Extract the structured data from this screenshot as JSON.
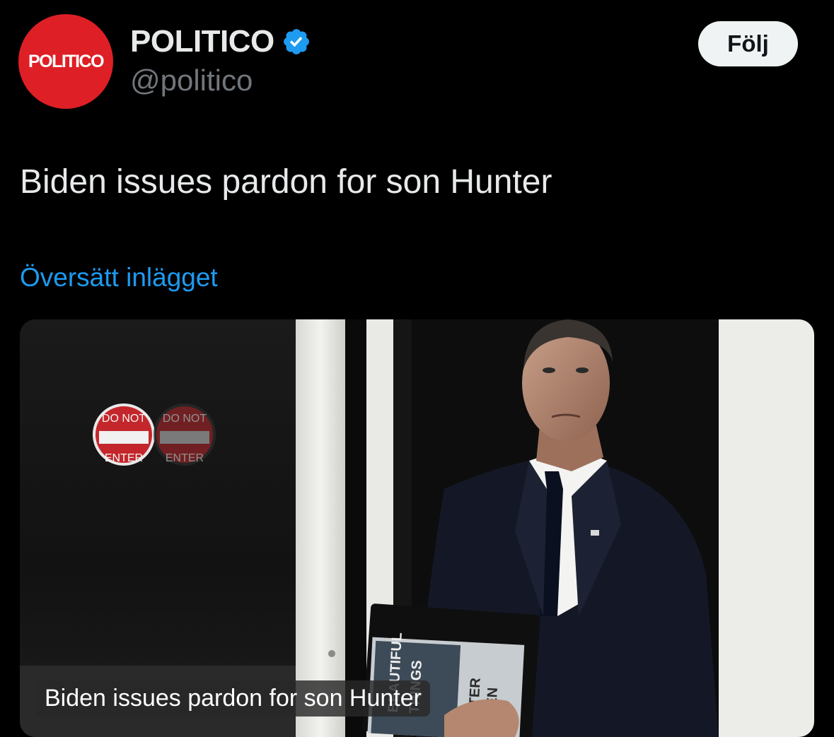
{
  "account": {
    "avatar_text": "POLITICO",
    "display_name": "POLITICO",
    "handle": "@politico",
    "verified_icon": "verified-badge-icon"
  },
  "follow_button": {
    "label": "Följ"
  },
  "tweet": {
    "text": "Biden issues pardon for son Hunter",
    "translate_label": "Översätt inlägget"
  },
  "media": {
    "caption": "Biden issues pardon for son Hunter",
    "sign_top": "DO NOT",
    "sign_bottom": "ENTER",
    "book_title_top": "BEAUTIFUL",
    "book_title_mid": "THINGS",
    "book_side_1": "TER",
    "book_side_2": "EN"
  },
  "colors": {
    "background": "#000000",
    "brand_red": "#de1f26",
    "link_blue": "#1d9bf0",
    "verified_blue": "#1d9bf0",
    "button_bg": "#eff3f4"
  }
}
